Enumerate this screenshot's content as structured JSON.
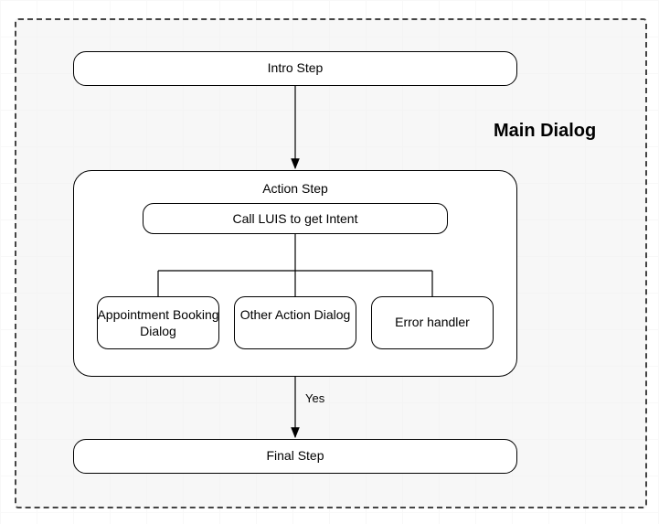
{
  "container": {
    "title": "Main Dialog"
  },
  "steps": {
    "intro": "Intro Step",
    "action": {
      "title": "Action Step",
      "luis": "Call LUIS to get Intent",
      "branches": {
        "appointment": "Appointment Booking Dialog",
        "other": "Other Action Dialog",
        "error": "Error handler"
      }
    },
    "final": "Final Step"
  },
  "edges": {
    "yes_label": "Yes"
  }
}
